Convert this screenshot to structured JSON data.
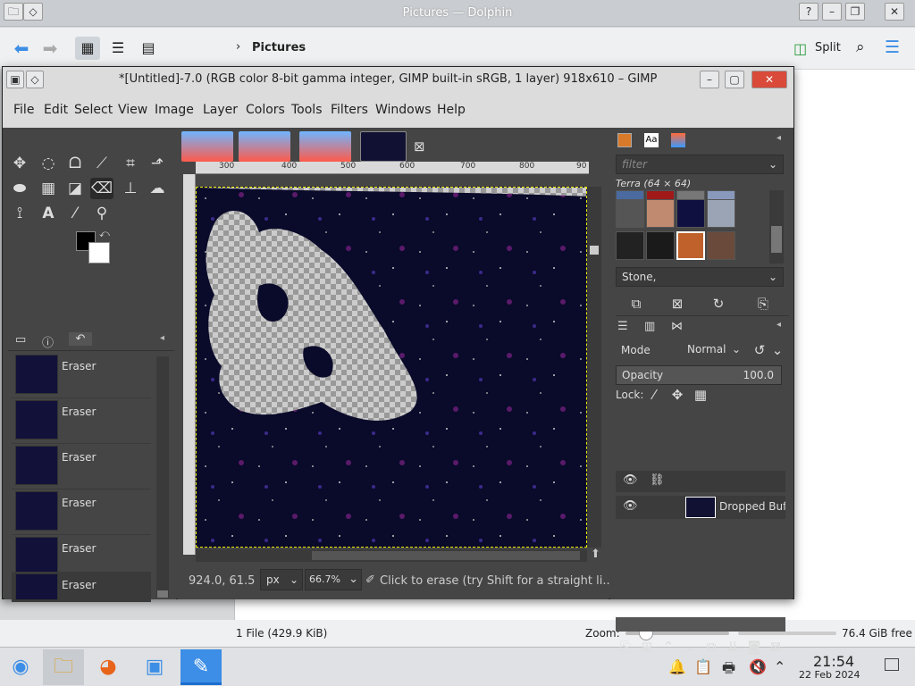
{
  "dolphin": {
    "window_title": "Pictures — Dolphin",
    "breadcrumb": "Pictures",
    "split_label": "Split",
    "status_files": "1 File (429.9 KiB)",
    "zoom_label": "Zoom:",
    "free_space": "76.4 GiB free",
    "zoom_value": 0.2
  },
  "gimp": {
    "window_title": "*[Untitled]-7.0 (RGB color 8-bit gamma integer, GIMP built-in sRGB, 1 layer) 918x610 – GIMP",
    "menu": [
      "File",
      "Edit",
      "Select",
      "View",
      "Image",
      "Layer",
      "Colors",
      "Tools",
      "Filters",
      "Windows",
      "Help"
    ],
    "undo_history": [
      {
        "label": "Eraser"
      },
      {
        "label": "Eraser"
      },
      {
        "label": "Eraser"
      },
      {
        "label": "Eraser"
      },
      {
        "label": "Eraser"
      },
      {
        "label": "Eraser"
      }
    ],
    "rulers": {
      "ticks": [
        "300",
        "400",
        "500",
        "600",
        "700",
        "800",
        "90"
      ]
    },
    "status": {
      "coords": "924.0, 61.5",
      "unit": "px",
      "zoom": "66.7%",
      "message": "Click to erase (try Shift for a straight li..."
    },
    "patterns": {
      "filter_placeholder": "filter",
      "selected_name": "Terra (64 × 64)",
      "tag_label": "Stone,"
    },
    "layers": {
      "mode_label": "Mode",
      "mode_value": "Normal",
      "opacity_label": "Opacity",
      "opacity_value": "100.0",
      "lock_label": "Lock:",
      "layer_name": "Dropped Buffe"
    },
    "colors": {
      "foreground": "#000000",
      "background": "#ffffff"
    }
  },
  "taskbar": {
    "time": "21:54",
    "date": "22 Feb 2024"
  }
}
